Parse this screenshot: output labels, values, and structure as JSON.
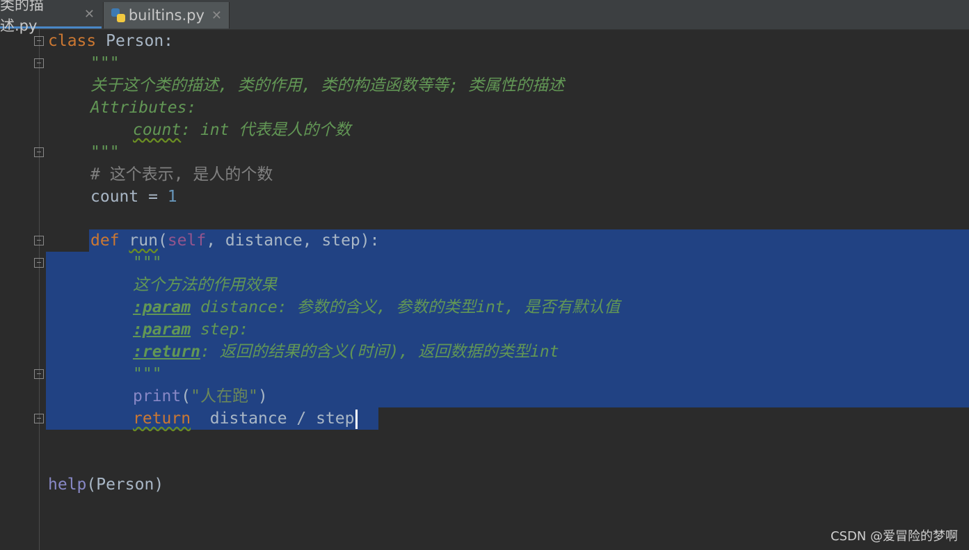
{
  "tabs": [
    {
      "label": "类的描述.py",
      "active": false
    },
    {
      "label": "builtins.py",
      "active": true
    }
  ],
  "code": {
    "class_kw": "class",
    "class_name": " Person:",
    "doc_open": "\"\"\"",
    "doc_desc": "关于这个类的描述, 类的作用, 类的构造函数等等; 类属性的描述",
    "doc_attr": "Attributes:",
    "doc_count_name": "count",
    "doc_count_rest": ": int 代表是人的个数",
    "doc_close": "\"\"\"",
    "comment": "# 这个表示, 是人的个数",
    "count_var": "count = ",
    "count_val": "1",
    "def_kw": "def",
    "fn_name": "run",
    "paren_open": "(",
    "self_kw": "self",
    "params": ", distance, step):",
    "m_doc_open": "\"\"\"",
    "m_doc_desc": "这个方法的作用效果",
    "param_tag": ":param",
    "param1_rest": " distance: 参数的含义, 参数的类型int, 是否有默认值",
    "param2_rest": " step:",
    "return_tag": ":return",
    "return_rest": ": 返回的结果的含义(时间), 返回数据的类型int",
    "m_doc_close": "\"\"\"",
    "print_fn": "print",
    "print_open": "(",
    "print_str": "\"人在跑\"",
    "print_close": ")",
    "return_kw": "return",
    "return_expr": "  distance / step",
    "help_fn": "help",
    "help_arg": "(Person)"
  },
  "watermark": "CSDN @爱冒险的梦啊",
  "colors": {
    "background": "#2b2b2b",
    "selection": "#214283",
    "keyword": "#cc7832",
    "docstring": "#629755"
  }
}
